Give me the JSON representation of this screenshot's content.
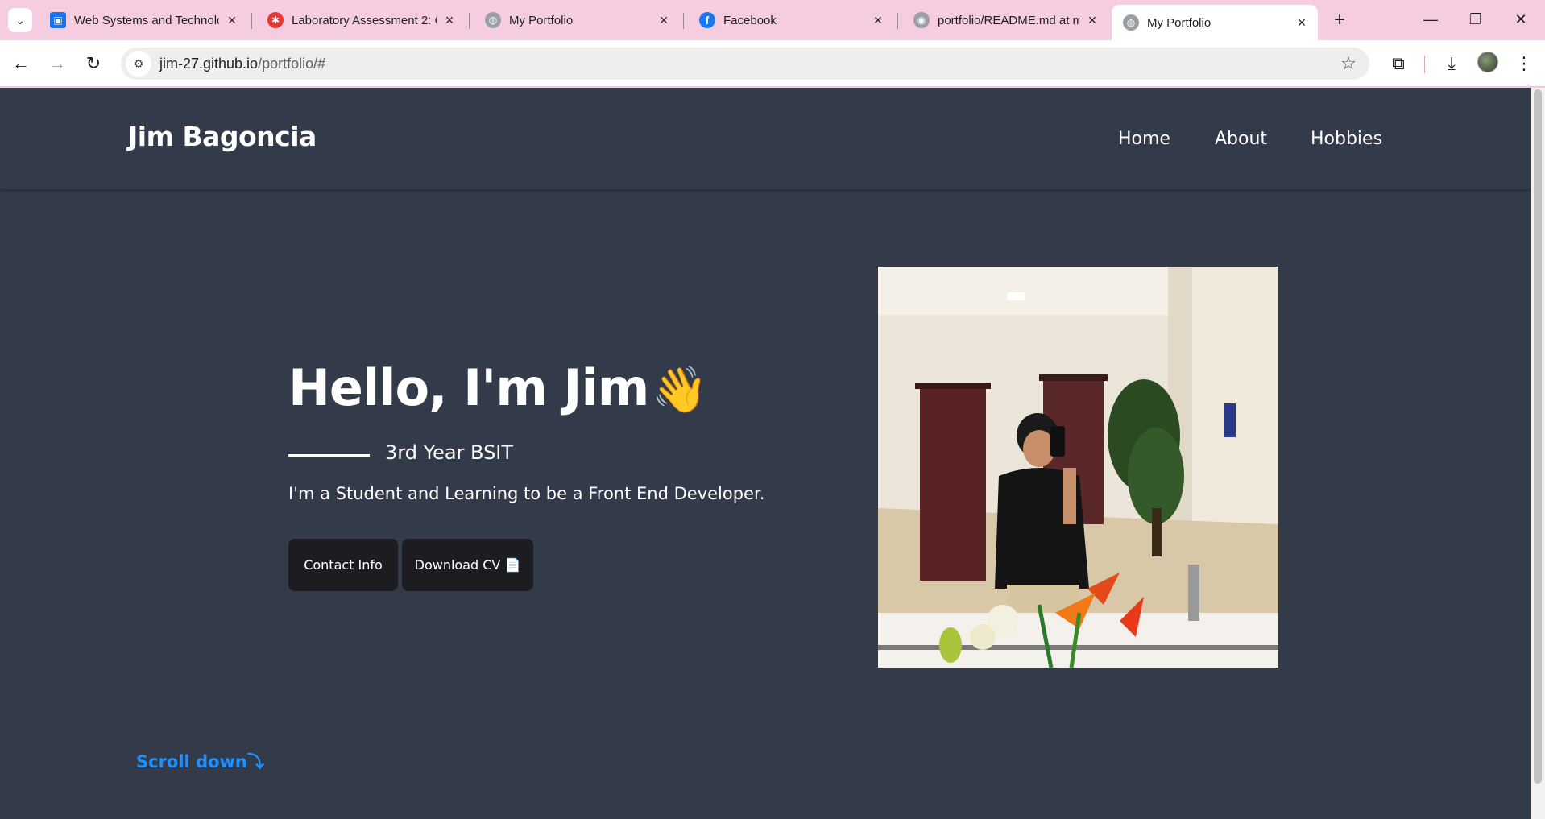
{
  "browser": {
    "tabs": [
      {
        "title": "Web Systems and Technolo",
        "favicon_color": "#1a73e8",
        "favicon_glyph": "▣",
        "icon": "classroom-icon"
      },
      {
        "title": "Laboratory Assessment 2: C",
        "favicon_color": "#e53935",
        "favicon_glyph": "✱",
        "icon": "canvas-icon"
      },
      {
        "title": "My Portfolio",
        "favicon_color": "#9aa0a6",
        "favicon_glyph": "◍",
        "icon": "globe-icon"
      },
      {
        "title": "Facebook",
        "favicon_color": "#1877f2",
        "favicon_glyph": "f",
        "icon": "facebook-icon"
      },
      {
        "title": "portfolio/README.md at m",
        "favicon_color": "#9aa0a6",
        "favicon_glyph": "◉",
        "icon": "github-icon"
      },
      {
        "title": "My Portfolio",
        "favicon_color": "#9aa0a6",
        "favicon_glyph": "◍",
        "icon": "globe-icon"
      }
    ],
    "active_tab_index": 5,
    "url_host": "jim-27.github.io",
    "url_path": "/portfolio/#"
  },
  "site": {
    "brand": "Jim Bagoncia",
    "nav": [
      {
        "label": "Home"
      },
      {
        "label": "About"
      },
      {
        "label": "Hobbies"
      }
    ],
    "hero": {
      "title": "Hello, I'm Jim",
      "title_emoji": "👋",
      "subtitle": "3rd Year BSIT",
      "tagline": "I'm a Student and Learning to be a Front End Developer.",
      "buttons": {
        "contact": "Contact Info",
        "download": "Download CV 📄"
      }
    },
    "scroll_down": "Scroll down⤵"
  },
  "colors": {
    "page_bg": "#333a4a",
    "button_bg": "#1d1c21",
    "scroll_link": "#1e90ff",
    "tabstrip_bg": "#f6cde0"
  }
}
